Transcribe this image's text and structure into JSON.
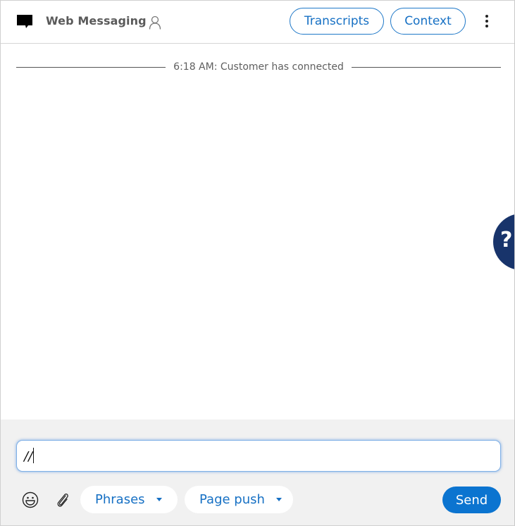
{
  "header": {
    "title": "Web Messaging",
    "icons": {
      "channel": "chat-bubble-icon",
      "participant": "user-icon",
      "more": "kebab-menu-icon"
    },
    "buttons": {
      "transcripts": "Transcripts",
      "context": "Context"
    }
  },
  "transcript": {
    "events": [
      {
        "text": "6:18 AM: Customer has connected"
      }
    ]
  },
  "help": {
    "label": "?"
  },
  "composer": {
    "input_value": "//",
    "icons": {
      "emoji": "emoji-icon",
      "attach": "paperclip-icon"
    },
    "phrases_label": "Phrases",
    "page_push_label": "Page push",
    "send_label": "Send"
  },
  "colors": {
    "accent": "#1670c4",
    "send_bg": "#0b74d0",
    "help_bg": "#18346b",
    "composer_bg": "#f1f1f1"
  }
}
